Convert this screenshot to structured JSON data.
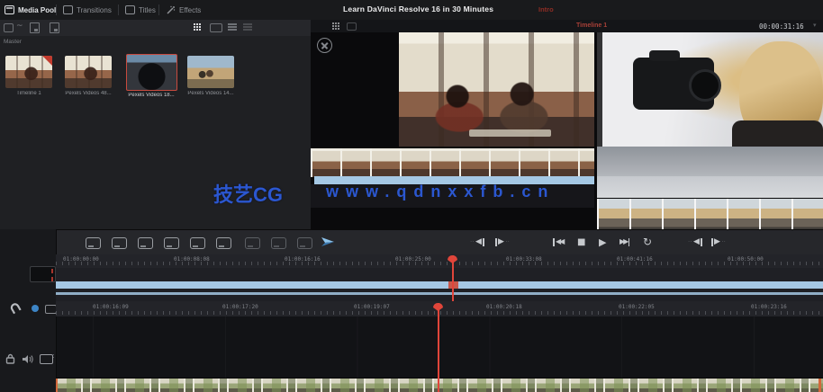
{
  "top_bar": {
    "tools": [
      {
        "label": "Media Pool"
      },
      {
        "label": "Transitions"
      },
      {
        "label": "Titles"
      },
      {
        "label": "Effects"
      }
    ],
    "video_title": "Learn DaVinci Resolve 16 in 30 Minutes",
    "video_title_badge": "Intro"
  },
  "media_pool": {
    "bin_label": "Master",
    "clips": [
      {
        "label": "Timeline 1"
      },
      {
        "label": "Pexels Videos 48..."
      },
      {
        "label": "Pexels Videos 18...",
        "selected": "true"
      },
      {
        "label": "Pexels Videos 14..."
      }
    ]
  },
  "viewer": {
    "timeline_name": "Timeline 1",
    "timecode": "00:00:31:16"
  },
  "watermark": {
    "brand": "技艺CG",
    "url": "www.qdnxxfb.cn"
  },
  "timeline": {
    "mini_ruler": [
      "01:00:00:00",
      "01:00:08:08",
      "01:00:16:16",
      "01:00:25:00",
      "01:00:33:08",
      "01:00:41:16",
      "01:00:50:00"
    ],
    "main_ruler": [
      "01:00:16:09",
      "01:00:17:20",
      "01:00:19:07",
      "01:00:20:18",
      "01:00:22:05",
      "01:00:23:16"
    ]
  },
  "icons": {
    "play": "▶",
    "stop": "■",
    "go_start": "◀◀",
    "go_end": "▶▶",
    "loop": "↻",
    "step_back": "◀",
    "step_forward": "▶",
    "chevron_down": "▾",
    "dots": "··",
    "wave": "~"
  },
  "colors": {
    "clip_blue": "#a5c8e4",
    "playhead_red": "#e0453a",
    "timeline_label_red": "#a94038",
    "watermark_blue": "#2b57d0",
    "selection_red": "#c84a3e"
  }
}
